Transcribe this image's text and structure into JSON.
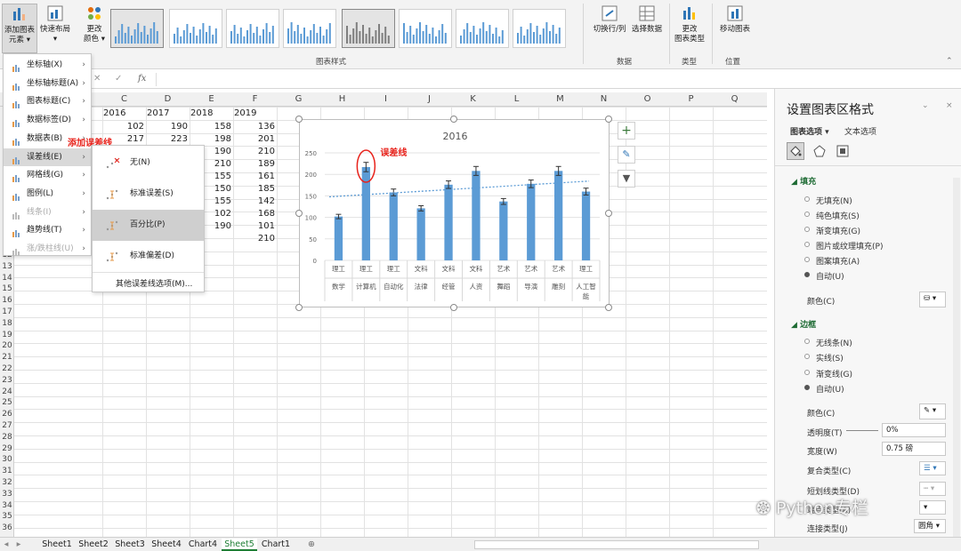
{
  "ribbon": {
    "add_element_l1": "添加图表",
    "add_element_l2": "元素",
    "quick_layout": "快速布局",
    "change_colors_l1": "更改",
    "change_colors_l2": "颜色",
    "styles_group": "图表样式",
    "switch_row_col": "切换行/列",
    "select_data": "选择数据",
    "data_group": "数据",
    "change_type_l1": "更改",
    "change_type_l2": "图表类型",
    "type_group": "类型",
    "move_chart": "移动图表",
    "location_group": "位置"
  },
  "formula_bar": {
    "fx": "fx",
    "cancel": "✕",
    "enter": "✓"
  },
  "columns": [
    "C",
    "D",
    "E",
    "F",
    "G",
    "H",
    "I",
    "J",
    "K",
    "L",
    "M",
    "N",
    "O",
    "P",
    "Q"
  ],
  "rows": [
    "12",
    "13",
    "14",
    "15",
    "16",
    "17",
    "18",
    "19",
    "20",
    "21",
    "22",
    "23",
    "24",
    "25",
    "26",
    "27",
    "28",
    "29",
    "30",
    "31",
    "32",
    "33",
    "34",
    "35",
    "36"
  ],
  "cells": {
    "years": [
      "2016",
      "2017",
      "2018",
      "2019"
    ],
    "r1": [
      "102",
      "190",
      "158",
      "136"
    ],
    "r2": [
      "217",
      "223",
      "198",
      "201"
    ],
    "c_e": [
      "190",
      "210",
      "155",
      "150",
      "155",
      "102",
      "190"
    ],
    "c_f": [
      "210",
      "189",
      "161",
      "185",
      "142",
      "168",
      "101",
      "210"
    ]
  },
  "menu": {
    "items": [
      {
        "label": "坐标轴(X)",
        "disabled": false
      },
      {
        "label": "坐标轴标题(A)",
        "disabled": false
      },
      {
        "label": "图表标题(C)",
        "disabled": false
      },
      {
        "label": "数据标签(D)",
        "disabled": false
      },
      {
        "label": "数据表(B)",
        "disabled": false
      },
      {
        "label": "误差线(E)",
        "disabled": false
      },
      {
        "label": "网格线(G)",
        "disabled": false
      },
      {
        "label": "图例(L)",
        "disabled": false
      },
      {
        "label": "线条(I)",
        "disabled": true
      },
      {
        "label": "趋势线(T)",
        "disabled": false
      },
      {
        "label": "涨/跌柱线(U)",
        "disabled": true
      }
    ],
    "annotation": "添加误差线"
  },
  "submenu": {
    "items": [
      "无(N)",
      "标准误差(S)",
      "百分比(P)",
      "标准偏差(D)"
    ],
    "more": "其他误差线选项(M)..."
  },
  "chart_data": {
    "type": "bar",
    "title": "2016",
    "categories": [
      [
        "理工",
        "数学"
      ],
      [
        "理工",
        "计算机"
      ],
      [
        "理工",
        "自动化"
      ],
      [
        "文科",
        "法律"
      ],
      [
        "文科",
        "经管"
      ],
      [
        "文科",
        "人资"
      ],
      [
        "艺术",
        "舞蹈"
      ],
      [
        "艺术",
        "导演"
      ],
      [
        "艺术",
        "雕刻"
      ],
      [
        "理工",
        "人工智能"
      ]
    ],
    "values": [
      102,
      217,
      158,
      121,
      176,
      208,
      137,
      178,
      208,
      160
    ],
    "error_bars": "percentage",
    "trendline": "linear-dotted",
    "ylim": [
      0,
      250
    ],
    "yticks": [
      0,
      50,
      100,
      150,
      200,
      250
    ],
    "grid": true,
    "bar_color": "#5b9bd5",
    "annotation": "误差线"
  },
  "panel": {
    "title": "设置图表区格式",
    "tab_chart": "图表选项",
    "tab_text": "文本选项",
    "fill_header": "填充",
    "fill_options": [
      "无填充(N)",
      "纯色填充(S)",
      "渐变填充(G)",
      "图片或纹理填充(P)",
      "图案填充(A)",
      "自动(U)"
    ],
    "color_label": "颜色(C)",
    "border_header": "边框",
    "border_options": [
      "无线条(N)",
      "实线(S)",
      "渐变线(G)",
      "自动(U)"
    ],
    "border_color_label": "颜色(C)",
    "transparency_label": "透明度(T)",
    "transparency_value": "0%",
    "width_label": "宽度(W)",
    "width_value": "0.75 磅",
    "compound_label": "复合类型(C)",
    "dash_label": "短划线类型(D)",
    "cap_label": "端点类型(A)",
    "join_label": "连接类型(J)",
    "join_value": "圆角"
  },
  "sheets": [
    "Sheet1",
    "Sheet2",
    "Sheet3",
    "Sheet4",
    "Chart4",
    "Sheet5",
    "Chart1"
  ],
  "watermark": "Python专栏"
}
